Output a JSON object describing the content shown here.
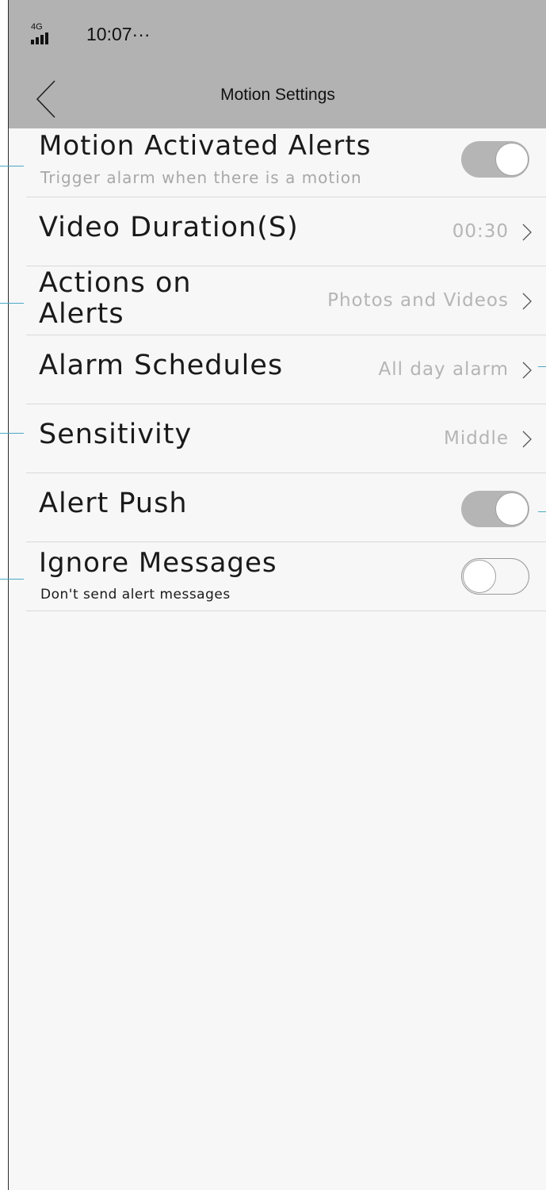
{
  "status_bar": {
    "network": "4G",
    "time": "10:07···"
  },
  "nav": {
    "title": "Motion Settings",
    "back_icon": "chevron-left-icon"
  },
  "settings": [
    {
      "label": "Motion Activated Alerts",
      "subtitle": "Trigger alarm when there is a motion",
      "toggle": true
    },
    {
      "label": "Video Duration(S)",
      "value": "00:30"
    },
    {
      "label": "Actions on Alerts",
      "value": "Photos and Videos"
    },
    {
      "label": "Alarm Schedules",
      "value": "All day alarm"
    },
    {
      "label": "Sensitivity",
      "value": "Middle"
    },
    {
      "label": "Alert Push",
      "toggle": true
    },
    {
      "label": "Ignore Messages",
      "subtitle": "Don't send alert messages",
      "toggle": false
    }
  ],
  "colors": {
    "bars": "#b2b2b2",
    "background": "#f7f7f7",
    "toggle_on": "#b5b5b5",
    "value_text": "#b5b5b5",
    "annotation_line": "#4aa9c4"
  }
}
